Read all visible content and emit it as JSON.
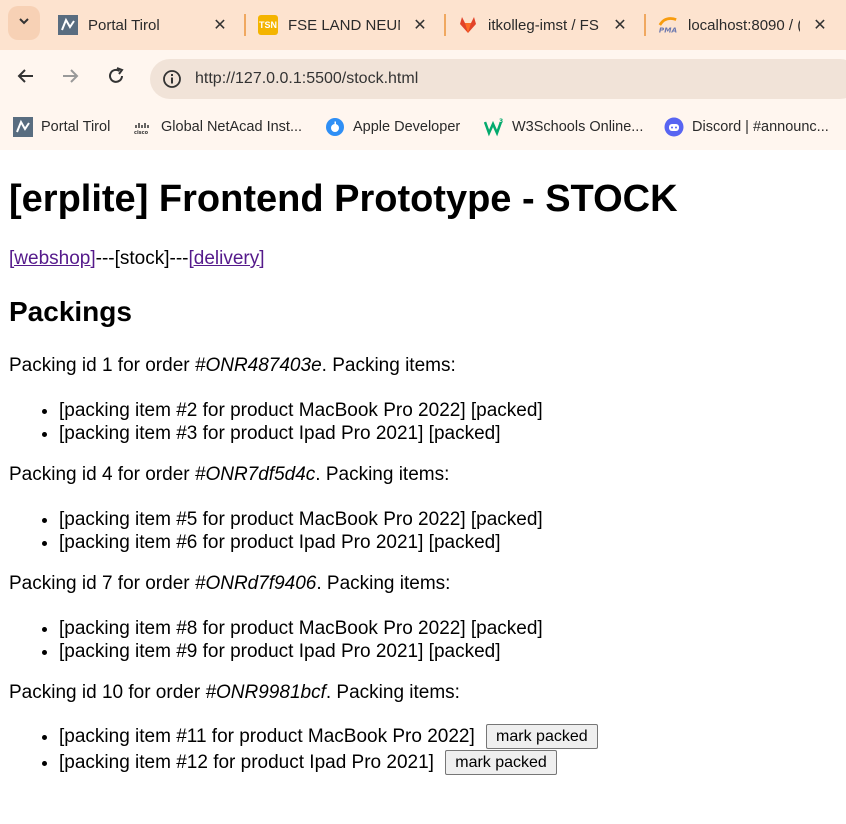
{
  "browser": {
    "tabs": [
      {
        "label": "Portal Tirol",
        "icon": "portal-tirol-icon"
      },
      {
        "label": "FSE LAND NEUN",
        "icon": "tsn-icon"
      },
      {
        "label": "itkolleg-imst / FS",
        "icon": "gitlab-icon"
      },
      {
        "label": "localhost:8090 / (",
        "icon": "phpmyadmin-icon"
      }
    ],
    "url": "http://127.0.0.1:5500/stock.html",
    "bookmarks": [
      {
        "label": "Portal Tirol",
        "icon": "portal-tirol-icon"
      },
      {
        "label": "Global NetAcad Inst...",
        "icon": "cisco-icon"
      },
      {
        "label": "Apple Developer",
        "icon": "apple-icon"
      },
      {
        "label": "W3Schools Online...",
        "icon": "w3schools-icon"
      },
      {
        "label": "Discord | #announc...",
        "icon": "discord-icon"
      }
    ]
  },
  "page": {
    "title": "[erplite] Frontend Prototype - STOCK",
    "nav": {
      "webshop": "[webshop]",
      "sep1": "---",
      "stock": "[stock]",
      "sep2": "---",
      "delivery": "[delivery]"
    },
    "section_title": "Packings",
    "packings": [
      {
        "prefix": "Packing id 1 for order ",
        "order": "#ONR487403e",
        "suffix": ". Packing items:",
        "items": [
          {
            "text": "[packing item #2 for product MacBook Pro 2022] [packed]"
          },
          {
            "text": "[packing item #3 for product Ipad Pro 2021] [packed]"
          }
        ]
      },
      {
        "prefix": "Packing id 4 for order ",
        "order": "#ONR7df5d4c",
        "suffix": ". Packing items:",
        "items": [
          {
            "text": "[packing item #5 for product MacBook Pro 2022] [packed]"
          },
          {
            "text": "[packing item #6 for product Ipad Pro 2021] [packed]"
          }
        ]
      },
      {
        "prefix": "Packing id 7 for order ",
        "order": "#ONRd7f9406",
        "suffix": ". Packing items:",
        "items": [
          {
            "text": "[packing item #8 for product MacBook Pro 2022] [packed]"
          },
          {
            "text": "[packing item #9 for product Ipad Pro 2021] [packed]"
          }
        ]
      },
      {
        "prefix": "Packing id 10 for order ",
        "order": "#ONR9981bcf",
        "suffix": ". Packing items:",
        "items": [
          {
            "text": "[packing item #11 for product MacBook Pro 2022]",
            "button": "mark packed"
          },
          {
            "text": "[packing item #12 for product Ipad Pro 2021]",
            "button": "mark packed"
          }
        ]
      }
    ]
  },
  "colors": {
    "tabstrip": "#fde3cf",
    "toolbar": "#fff6ef",
    "visited_link": "#551a8b"
  }
}
